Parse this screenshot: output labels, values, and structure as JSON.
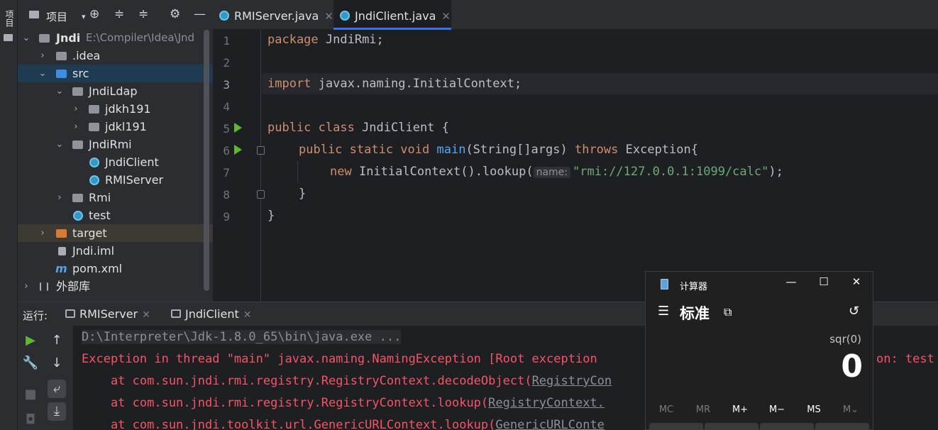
{
  "stripe": {
    "label": "项目"
  },
  "project_panel": {
    "title": "项目",
    "items": [
      {
        "label": "Jndi",
        "extra": "E:\\Compiler\\Idea\\Jnd"
      },
      {
        "label": ".idea"
      },
      {
        "label": "src"
      },
      {
        "label": "JndiLdap"
      },
      {
        "label": "jdkh191"
      },
      {
        "label": "jdkl191"
      },
      {
        "label": "JndiRmi"
      },
      {
        "label": "JndiClient"
      },
      {
        "label": "RMIServer"
      },
      {
        "label": "Rmi"
      },
      {
        "label": "test"
      },
      {
        "label": "target"
      },
      {
        "label": "Jndi.iml"
      },
      {
        "label": "pom.xml"
      },
      {
        "label": "外部库"
      }
    ]
  },
  "editor_tabs": [
    {
      "label": "RMIServer.java"
    },
    {
      "label": "JndiClient.java"
    }
  ],
  "editor": {
    "line_numbers": [
      "1",
      "2",
      "3",
      "4",
      "5",
      "6",
      "7",
      "8",
      "9"
    ],
    "l1": {
      "kw": "package",
      "rest": " JndiRmi;"
    },
    "l3": {
      "kw": "import",
      "rest": " javax.naming.InitialContext;"
    },
    "l5": {
      "kw": "public class",
      "rest": " JndiClient {"
    },
    "l6": {
      "kw": "public static void",
      "fn": "main",
      "args": "(String[]args) ",
      "kw2": "throws",
      "rest": " Exception{"
    },
    "l7": {
      "kw": "new",
      "rest": " InitialContext().lookup(",
      "hint": "name:",
      "str": "\"rmi://127.0.0.1:1099/calc\"",
      "end": ");"
    },
    "l8": "}",
    "l9": "}"
  },
  "run_panel": {
    "label": "运行:",
    "tabs": [
      {
        "label": "RMIServer"
      },
      {
        "label": "JndiClient"
      }
    ]
  },
  "console": {
    "line1": "D:\\Interpreter\\Jdk-1.8.0_65\\bin\\java.exe ...",
    "line2": "Exception in thread \"main\" javax.naming.NamingException [Root exception",
    "line2_tail": "on: test",
    "line3": "    at com.sun.jndi.rmi.registry.RegistryContext.decodeObject(",
    "line3_link": "RegistryCon",
    "line4": "    at com.sun.jndi.rmi.registry.RegistryContext.lookup(",
    "line4_link": "RegistryContext.",
    "line5": "    at com.sun.jndi.toolkit.url.GenericURLContext.lookup(",
    "line5_link": "GenericURLConte"
  },
  "calculator": {
    "title": "计算器",
    "mode": "标准",
    "expression": "sqr(0)",
    "display": "0",
    "memory_keys": [
      "MC",
      "MR",
      "M+",
      "M−",
      "MS",
      "M⌄"
    ]
  }
}
